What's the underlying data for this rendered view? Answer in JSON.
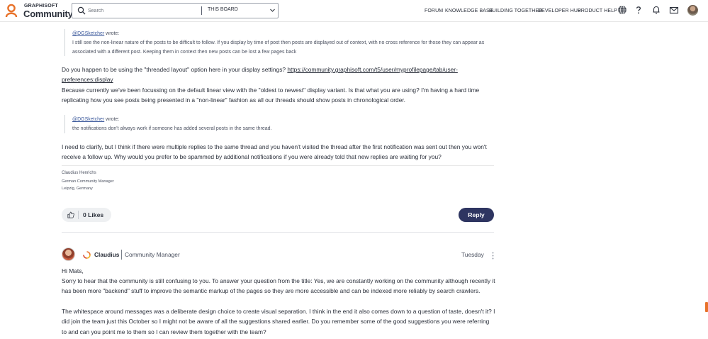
{
  "header": {
    "logo_top": "GRAPHISOFT",
    "logo_bottom": "Community",
    "search_placeholder": "Search",
    "board_select": "THIS BOARD",
    "nav": [
      "FORUM",
      "KNOWLEDGE BASE",
      "BUILDING TOGETHER",
      "DEVELOPER HUB",
      "PRODUCT HELP"
    ]
  },
  "colors": {
    "brand_orange": "#e8722a",
    "reply_button": "#2e3561"
  },
  "post1": {
    "quote1": {
      "mention": "@DGSketcher",
      "wrote": " wrote:",
      "text": "I still see the non-linear nature of the posts to be difficult to follow. If you display by time of post then posts are displayed out of context, with no cross reference for those they can appear as associated with a different post. Keeping them in context then new posts can be lost a few pages back"
    },
    "para1_text": "Do you happen to be using the \"threaded layout\" option here in your display settings? ",
    "para1_link": "https://community.graphisoft.com/t5/user/myprofilepage/tab/user-preferences:display",
    "para2": "Because currently we've been focussing on the default linear view with the \"oldest to newest\" display variant. Is that what you are using? I'm having a hard time replicating how you see posts being presented in a \"non-linear\" fashion as all our threads should show posts in chronological order.",
    "quote2": {
      "mention": "@DGSketcher",
      "wrote": " wrote:",
      "text": "the notifications don't always work if someone has added several posts in the same thread."
    },
    "para3": "I need to clarify, but I think if there were multiple replies to the same thread and you haven't visited the thread after the first notification was sent out then you won't receive a follow up. Why would you prefer to be spammed by additional notifications if you were already told that new replies are waiting for you?",
    "signature": {
      "name": "Claudius Henrichs",
      "title": "German Community Manager",
      "location": "Leipzig, Germany"
    },
    "likes": "0 Likes",
    "reply": "Reply"
  },
  "post2": {
    "author": "Claudius",
    "role": "Community Manager",
    "date": "Tuesday",
    "greeting": "Hi Mats,",
    "para1": "Sorry to hear that the community is still confusing to you. To answer your question from the title: Yes, we are constantly working on the community although recently it has been more \"backend\" stuff to improve the semantic markup of the pages so they are more accessible and can be indexed more reliably by search crawlers.",
    "para2": "The whitespace around messages was a deliberate design choice to create visual separation. I think in the end it also comes down to a question of taste, doesn't it? I did join the team just this October so I might not be aware of all the suggestions shared earlier. Do you remember some of the good suggestions you were referring to and can you point me to them so I can review them together with the team?"
  }
}
